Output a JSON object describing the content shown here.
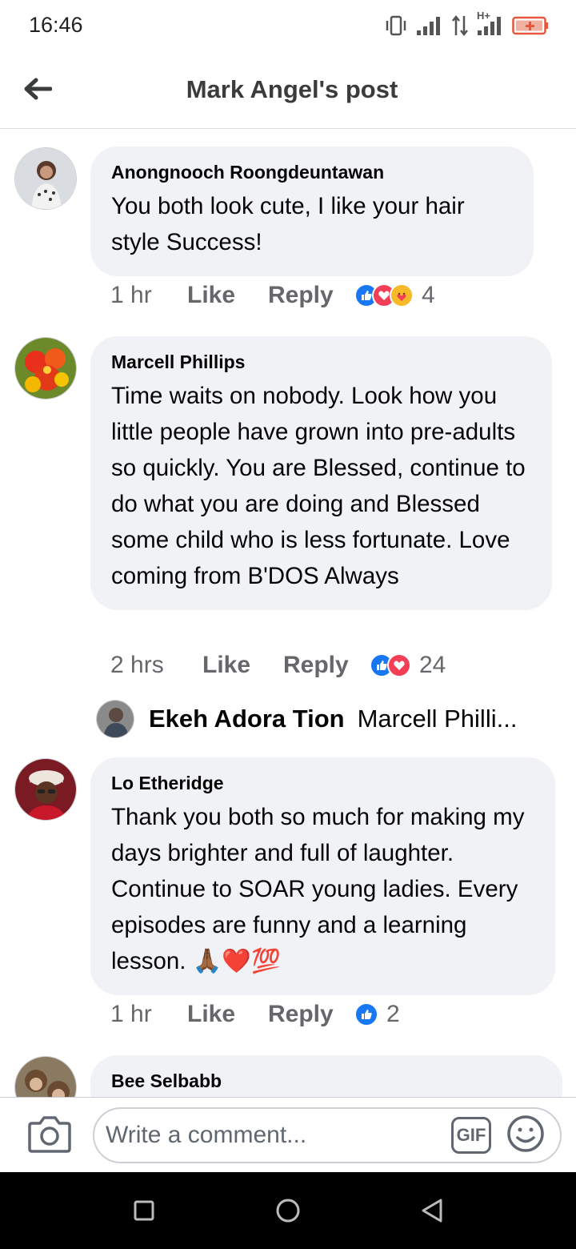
{
  "status_bar": {
    "time": "16:46",
    "network_label": "H+"
  },
  "header": {
    "back_icon": "arrow-left-icon",
    "title": "Mark Angel's post"
  },
  "comments": [
    {
      "author": "Anongnooch Roongdeuntawan",
      "text": "You both look cute, I like your hair style Success!",
      "time": "1 hr",
      "like_label": "Like",
      "reply_label": "Reply",
      "reactions": [
        "like",
        "love",
        "care"
      ],
      "reaction_count": "4"
    },
    {
      "author": "Marcell Phillips",
      "text": "Time waits on nobody. Look how you little people have grown into pre-adults so quickly. You are Blessed, continue to do what you are doing and Blessed some child who is less fortunate. Love coming from B'DOS Always",
      "time": "2 hrs",
      "like_label": "Like",
      "reply_label": "Reply",
      "reactions": [
        "like",
        "love"
      ],
      "reaction_count": "24",
      "reply_preview": {
        "author": "Ekeh Adora Tion",
        "text": "Marcell Philli..."
      }
    },
    {
      "author": "Lo Etheridge",
      "text": "Thank you both so much for making my days brighter and full of laughter. Continue to SOAR young ladies.  Every episodes are funny and a learning lesson.  🙏🏾❤️💯",
      "time": "1 hr",
      "like_label": "Like",
      "reply_label": "Reply",
      "reactions": [
        "like"
      ],
      "reaction_count": "2"
    },
    {
      "author": "Bee Selbabb"
    }
  ],
  "composer": {
    "placeholder": "Write a comment...",
    "gif_label": "GIF",
    "camera_icon": "camera-icon",
    "emoji_icon": "smiley-icon"
  },
  "colors": {
    "bubble_bg": "#f0f2f5",
    "like_blue": "#1877f2",
    "love_red": "#f33e58",
    "care_yellow": "#f7b928"
  }
}
